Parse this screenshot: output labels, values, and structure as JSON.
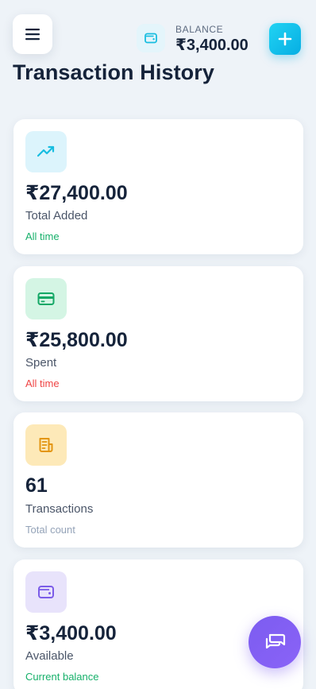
{
  "header": {
    "balance_label": "BALANCE",
    "balance_value": "₹3,400.00"
  },
  "page": {
    "title": "Transaction History"
  },
  "cards": [
    {
      "value": "₹27,400.00",
      "label": "Total Added",
      "sub": "All time",
      "sub_color": "#16b06a",
      "icon": "trending-up-icon"
    },
    {
      "value": "₹25,800.00",
      "label": "Spent",
      "sub": "All time",
      "sub_color": "#ef4444",
      "icon": "credit-card-icon"
    },
    {
      "value": "61",
      "label": "Transactions",
      "sub": "Total count",
      "sub_color": "#94a3b8",
      "icon": "receipt-icon"
    },
    {
      "value": "₹3,400.00",
      "label": "Available",
      "sub": "Current balance",
      "sub_color": "#16b06a",
      "icon": "wallet-icon"
    }
  ],
  "colors": {
    "accent": "#06aee3",
    "chat_fab": "#7c5cf0"
  }
}
